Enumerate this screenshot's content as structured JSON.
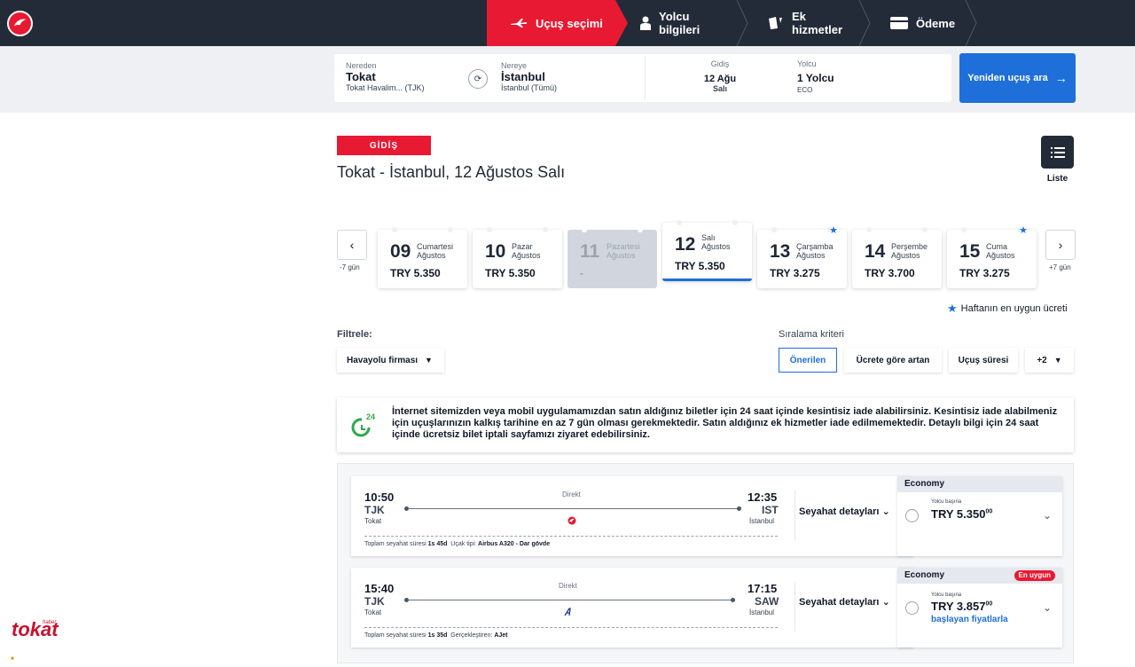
{
  "steps": [
    {
      "label": "Uçuş seçimi",
      "icon": "plane-icon"
    },
    {
      "label": "Yolcu bilgileri",
      "icon": "person-icon"
    },
    {
      "label": "Ek hizmetler",
      "icon": "extras-icon"
    },
    {
      "label": "Ödeme",
      "icon": "card-icon"
    }
  ],
  "search": {
    "from_label": "Nereden",
    "from_city": "Tokat",
    "from_airport": "Tokat Havalim... (TJK)",
    "to_label": "Nereye",
    "to_city": "İstanbul",
    "to_airport": "İstanbul (Tümü)",
    "date_label": "Gidiş",
    "date_value": "12 Ağu",
    "date_day": "Salı",
    "pax_label": "Yolcu",
    "pax_value": "1 Yolcu",
    "cabin": "ECO",
    "research_btn": "Yeniden uçuş ara"
  },
  "header": {
    "badge": "GİDİŞ",
    "title": "Tokat - İstanbul, 12 Ağustos Salı",
    "list_label": "Liste"
  },
  "dates": {
    "prev_label": "-7 gün",
    "next_label": "+7 gün",
    "items": [
      {
        "day": "09",
        "weekday": "Cumartesi",
        "month": "Ağustos",
        "price": "TRY 5.350"
      },
      {
        "day": "10",
        "weekday": "Pazar",
        "month": "Ağustos",
        "price": "TRY 5.350"
      },
      {
        "day": "11",
        "weekday": "Pazartesi",
        "month": "Ağustos",
        "price": "-"
      },
      {
        "day": "12",
        "weekday": "Salı",
        "month": "Ağustos",
        "price": "TRY 5.350"
      },
      {
        "day": "13",
        "weekday": "Çarşamba",
        "month": "Ağustos",
        "price": "TRY 3.275"
      },
      {
        "day": "14",
        "weekday": "Perşembe",
        "month": "Ağustos",
        "price": "TRY 3.700"
      },
      {
        "day": "15",
        "weekday": "Cuma",
        "month": "Ağustos",
        "price": "TRY 3.275"
      }
    ],
    "legend": "Haftanın en uygun ücreti"
  },
  "filters": {
    "label": "Filtrele:",
    "airline": "Havayolu firması",
    "sort_label": "Sıralama kriteri",
    "sort_options": [
      "Önerilen",
      "Ücrete göre artan",
      "Uçuş süresi",
      "+2"
    ]
  },
  "info": {
    "icon_text": "24",
    "text": "İnternet sitemizden veya mobil uygulamamızdan satın aldığınız biletler için 24 saat içinde kesintisiz iade alabilirsiniz. Kesintisiz iade alabilmeniz için uçuşlarınızın kalkış tarihine en az 7 gün olması gerekmektedir. Satın aldığınız ek hizmetler iade edilmemektedir. Detaylı bilgi için 24 saat içinde ücretsiz bilet iptali sayfamızı ziyaret edebilirsiniz."
  },
  "flights": [
    {
      "dep_time": "10:50",
      "dep_code": "TJK",
      "dep_city": "Tokat",
      "arr_time": "12:35",
      "arr_code": "IST",
      "arr_city": "İstanbul",
      "type": "Direkt",
      "duration_label": "Toplam seyahat süresi",
      "duration": "1s 45d",
      "extra_label": "Uçak tipi:",
      "extra_value": "Airbus A320 - Dar gövde",
      "details": "Seyahat detayları",
      "cabin": "Economy",
      "badge": "",
      "per_pax": "Yolcu başına",
      "price": "TRY 5.350",
      "price_dec": "00",
      "from_text": ""
    },
    {
      "dep_time": "15:40",
      "dep_code": "TJK",
      "dep_city": "Tokat",
      "arr_time": "17:15",
      "arr_code": "SAW",
      "arr_city": "İstanbul",
      "type": "Direkt",
      "duration_label": "Toplam seyahat süresi",
      "duration": "1s 35d",
      "extra_label": "Gerçekleştiren:",
      "extra_value": "AJet",
      "details": "Seyahat detayları",
      "cabin": "Economy",
      "badge": "En uygun",
      "per_pax": "Yolcu başına",
      "price": "TRY 3.857",
      "price_dec": "00",
      "from_text": "başlayan fiyatlarla"
    }
  ],
  "watermark": {
    "brand": "tokat",
    "sub": "haber"
  }
}
